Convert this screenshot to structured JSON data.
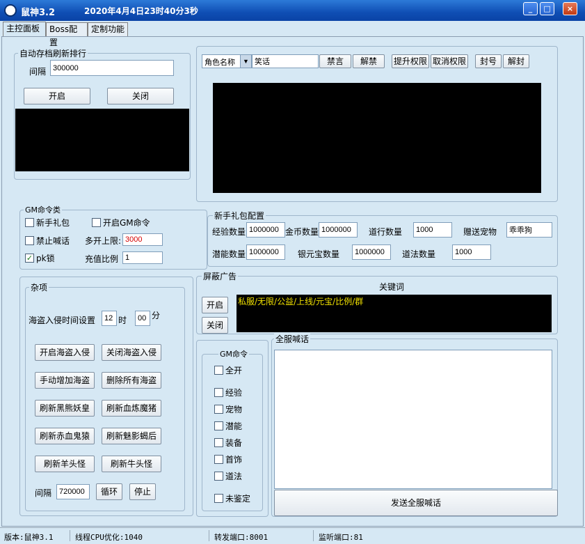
{
  "window": {
    "title": "鼠神3.2",
    "datetime": "2020年4月4日23时40分3秒",
    "minimize": "_",
    "maximize": "□",
    "close": "×"
  },
  "tabs": [
    "主控面板",
    "Boss配置",
    "定制功能"
  ],
  "autosave": {
    "title": "自动存档刷新排行",
    "interval_label": "间隔",
    "interval_value": "300000",
    "start": "开启",
    "stop": "关闭"
  },
  "role": {
    "select_value": "角色名称",
    "search_value": "笑话",
    "buttons": [
      "禁言",
      "解禁",
      "提升权限",
      "取消权限",
      "封号",
      "解封"
    ]
  },
  "gm_cmd": {
    "title": "GM命令类",
    "newbie_gift": "新手礼包",
    "enable_gm": "开启GM命令",
    "forbid_shout": "禁止喊话",
    "multi_limit_label": "多开上限:",
    "multi_limit_value": "3000",
    "pk_lock": "pk锁",
    "recharge_label": "充值比例",
    "recharge_value": "1"
  },
  "newbie": {
    "title": "新手礼包配置",
    "exp_label": "经验数量",
    "exp_value": "1000000",
    "gold_label": "金币数量",
    "gold_value": "1000000",
    "dao_label": "道行数量",
    "dao_value": "1000",
    "pet_label": "赠送宠物",
    "pet_value": "乖乖狗",
    "potential_label": "潜能数量",
    "potential_value": "1000000",
    "silver_label": "银元宝数量",
    "silver_value": "1000000",
    "magic_label": "道法数量",
    "magic_value": "1000"
  },
  "misc": {
    "title": "杂项",
    "pirate_label": "海盗入侵时间设置",
    "hour_value": "12",
    "hour_unit": "时",
    "min_value": "00",
    "min_unit": "分",
    "buttons": [
      [
        "开启海盗入侵",
        "关闭海盗入侵"
      ],
      [
        "手动增加海盗",
        "删除所有海盗"
      ],
      [
        "刷新黑熊妖皇",
        "刷新血炼魔猪"
      ],
      [
        "刷新赤血鬼猿",
        "刷新魅影蝎后"
      ],
      [
        "刷新羊头怪",
        "刷新牛头怪"
      ]
    ],
    "interval_label": "间隔",
    "interval_value": "720000",
    "loop": "循环",
    "stop": "停止"
  },
  "ads": {
    "title": "屏蔽广告",
    "keyword_label": "关键词",
    "start": "开启",
    "stop": "关闭",
    "keywords": "私服/无限/公益/上线/元宝/比例/群"
  },
  "gm_opts": {
    "title": "GM命令",
    "items": [
      "全开",
      "经验",
      "宠物",
      "潜能",
      "装备",
      "首饰",
      "道法",
      "未鉴定"
    ]
  },
  "shout": {
    "title": "全服喊话",
    "send": "发送全服喊话"
  },
  "statusbar": {
    "version": "版本:鼠神3.1",
    "cpu": "线程CPU优化:1040",
    "forward": "转发端口:8001",
    "listen": "监听端口:81"
  },
  "colors": {
    "window_bg": "#d6e8f4",
    "title_bar": "#0f4eb4",
    "limit_value": "#d40000",
    "keyword_text": "#f0e000"
  }
}
